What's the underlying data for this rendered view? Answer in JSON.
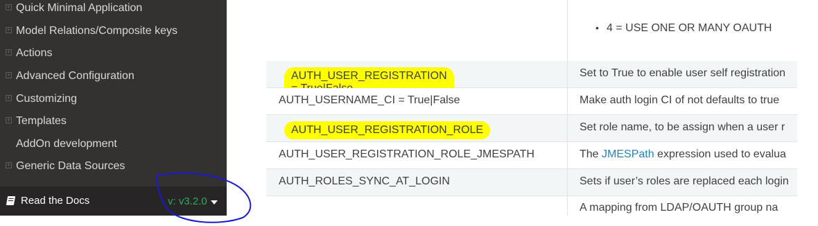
{
  "sidebar": {
    "items": [
      {
        "label": "Quick Minimal Application",
        "has_toggle": true
      },
      {
        "label": "Model Relations/Composite keys",
        "has_toggle": true
      },
      {
        "label": "Actions",
        "has_toggle": true
      },
      {
        "label": "Advanced Configuration",
        "has_toggle": true
      },
      {
        "label": "Customizing",
        "has_toggle": true
      },
      {
        "label": "Templates",
        "has_toggle": true
      },
      {
        "label": "AddOn development",
        "has_toggle": false
      },
      {
        "label": "Generic Data Sources",
        "has_toggle": true
      }
    ],
    "toggle_glyph": "⊞",
    "rtd": {
      "label": "Read the Docs",
      "version": "v: v3.2.0",
      "icon": "book-icon",
      "caret_icon": "caret-down-icon"
    }
  },
  "table": {
    "top_bullet": "4 = USE ONE OR MANY OAUTH",
    "rows": [
      {
        "key": "AUTH_USER_REGISTRATION = True|False",
        "value": "Set to True to enable user self registration",
        "highlight": true
      },
      {
        "key": "AUTH_USERNAME_CI = True|False",
        "value": "Make auth login CI of not defaults to true",
        "highlight": false
      },
      {
        "key": "AUTH_USER_REGISTRATION_ROLE",
        "value": "Set role name, to be assign when a user r",
        "highlight": true
      },
      {
        "key": "AUTH_USER_REGISTRATION_ROLE_JMESPATH",
        "value_prefix": "The ",
        "value_link": "JMESPath",
        "value_suffix": " expression used to evalua",
        "highlight": false
      },
      {
        "key": "AUTH_ROLES_SYNC_AT_LOGIN",
        "value": "Sets if user’s roles are replaced each login",
        "highlight": false
      },
      {
        "key": "",
        "value": "A mapping from LDAP/OAUTH group na",
        "highlight": false
      }
    ]
  },
  "colors": {
    "sidebar_bg": "#343131",
    "rtd_bg": "#272525",
    "version_green": "#27ae60",
    "highlight": "#ffff00",
    "link": "#2980b9",
    "annotation_circle": "#1a1ad0"
  }
}
